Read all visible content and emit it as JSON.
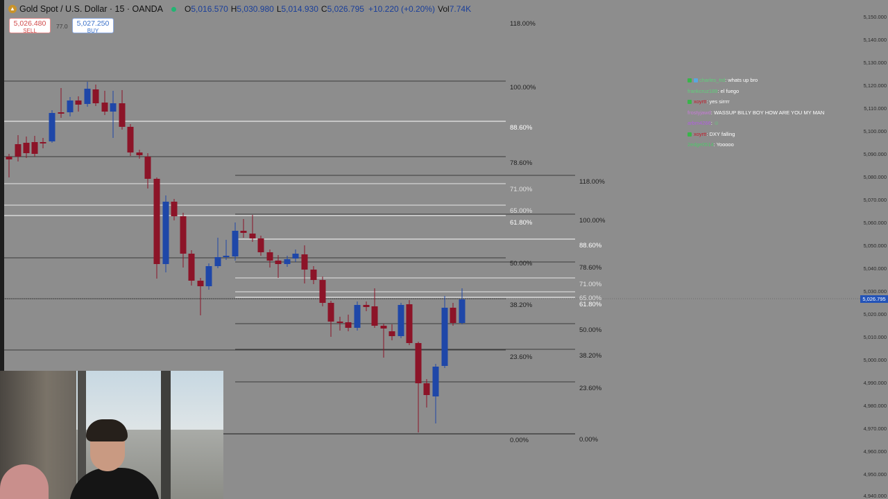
{
  "header": {
    "symbol_title": "Gold Spot / U.S. Dollar · 15 · OANDA",
    "ohlc": [
      {
        "k": "O",
        "v": "5,016.570"
      },
      {
        "k": "H",
        "v": "5,030.980"
      },
      {
        "k": "L",
        "v": "5,014.930"
      },
      {
        "k": "C",
        "v": "5,026.795"
      }
    ],
    "change": "+10.220 (+0.20%)",
    "vol_label": "Vol",
    "vol_value": "7.74K"
  },
  "trade": {
    "sell_price": "5,026.480",
    "sell_label": "SELL",
    "spread": "77.0",
    "buy_price": "5,027.250",
    "buy_label": "BUY"
  },
  "price_axis": {
    "labels": [
      "5,150.000",
      "5,140.000",
      "5,130.000",
      "5,120.000",
      "5,110.000",
      "5,100.000",
      "5,090.000",
      "5,080.000",
      "5,070.000",
      "5,060.000",
      "5,050.000",
      "5,040.000",
      "5,030.000",
      "5,020.000",
      "5,010.000",
      "5,000.000",
      "4,990.000",
      "4,980.000",
      "4,970.000",
      "4,960.000",
      "4,950.000",
      "4,940.000"
    ],
    "current_price": "5,026.795"
  },
  "fib_big": [
    "118.00%",
    "100.00%",
    "88.60%",
    "78.60%",
    "71.00%",
    "65.00%",
    "61.80%",
    "50.00%",
    "38.20%",
    "23.60%",
    "0.00%"
  ],
  "fib_small": [
    "118.00%",
    "100.00%",
    "88.60%",
    "78.60%",
    "71.00%",
    "65.00%",
    "61.80%",
    "50.00%",
    "38.20%",
    "23.60%",
    "0.00%"
  ],
  "colors": {
    "bull": "#1f47a8",
    "bear": "#8c1428",
    "background": "#8d8d8d",
    "accent": "#2353b8"
  },
  "chat": [
    {
      "user": "charles_trd",
      "text": "whats up bro",
      "color": "#5fd07a",
      "icons": 2
    },
    {
      "user": "frankcruz189",
      "text": "el fuego",
      "color": "#5fd07a",
      "icons": 0
    },
    {
      "user": "xoyrtt",
      "text": "yes sirrrr",
      "color": "#c41a2a",
      "icons": 1
    },
    {
      "user": "frostyjawd",
      "text": "WASSUP BILLY BOY HOW ARE YOU MY MAN",
      "color": "#c77ad8",
      "icons": 0
    },
    {
      "user": "arbm4266",
      "text": "☺",
      "color": "#b25ee0",
      "icons": 0
    },
    {
      "user": "xoyrtt",
      "text": "DXY falling",
      "color": "#c41a2a",
      "icons": 1
    },
    {
      "user": "2edge0514",
      "text": "Yooooo",
      "color": "#4fc76a",
      "icons": 0
    }
  ]
}
